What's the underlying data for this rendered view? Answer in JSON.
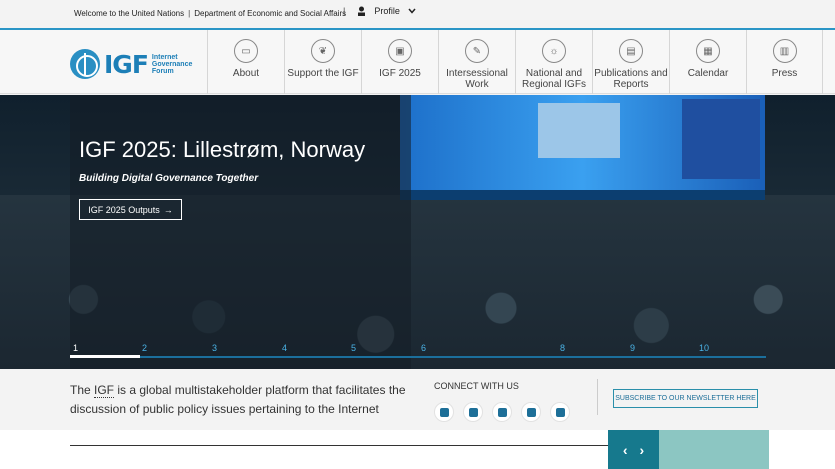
{
  "topbar": {
    "link_un": "Welcome to the United Nations",
    "separator": "|",
    "link_desa": "Department of Economic and Social Affairs",
    "profile_label": "Profile"
  },
  "logo": {
    "name": "IGF",
    "line1": "Internet",
    "line2": "Governance",
    "line3": "Forum"
  },
  "nav": {
    "items": [
      {
        "label": "About",
        "icon": "about-icon"
      },
      {
        "label": "Support the IGF",
        "icon": "support-icon"
      },
      {
        "label": "IGF 2025",
        "icon": "calendar-icon"
      },
      {
        "label": "Intersessional Work",
        "icon": "pencil-icon"
      },
      {
        "label": "National and Regional IGFs",
        "icon": "lightbulb-icon"
      },
      {
        "label": "Publications and Reports",
        "icon": "document-icon"
      },
      {
        "label": "Calendar",
        "icon": "calendar-grid-icon"
      },
      {
        "label": "Press",
        "icon": "press-icon"
      }
    ]
  },
  "hero": {
    "title": "IGF 2025: Lillestrøm, Norway",
    "subtitle": "Building Digital Governance Together",
    "button_label": "IGF 2025 Outputs",
    "slides": [
      "1",
      "2",
      "3",
      "4",
      "5",
      "6",
      "8",
      "9",
      "10"
    ],
    "active_slide": "1"
  },
  "intro": {
    "text_before": "The ",
    "igf_link": "IGF",
    "text_after": " is a global multistakeholder platform that facilitates the discussion of public policy issues pertaining to the Internet"
  },
  "connect": {
    "label": "CONNECT WITH US",
    "networks": [
      "twitter-icon",
      "facebook-icon",
      "youtube-icon",
      "instagram-icon",
      "flickr-icon"
    ]
  },
  "subscribe": {
    "label": "SUBSCRIBE TO OUR NEWSLETTER HERE"
  },
  "carousel": {
    "prev": "‹",
    "next": "›"
  }
}
